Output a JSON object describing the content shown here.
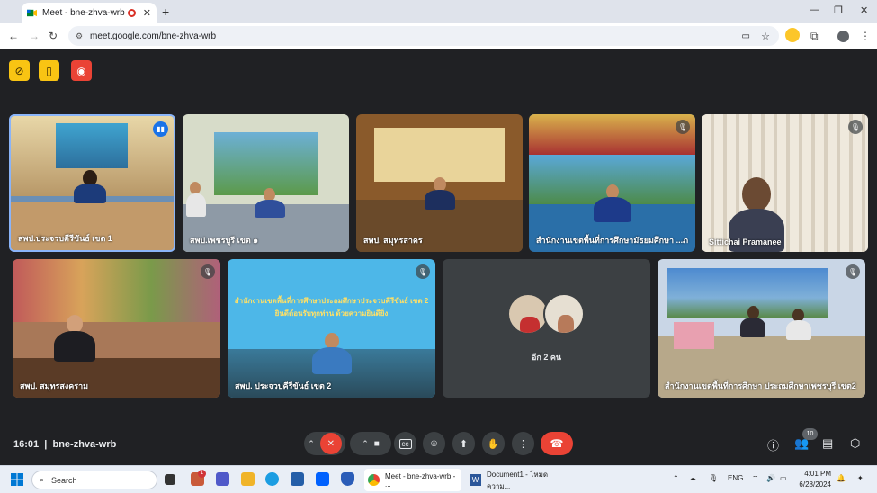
{
  "browser": {
    "tab_title": "Meet - bne-zhva-wrb",
    "tab_close": "✕",
    "new_tab": "+",
    "minimize": "—",
    "maximize": "❐",
    "close": "✕",
    "url": "meet.google.com/bne-zhva-wrb"
  },
  "meet": {
    "tiles": [
      {
        "name": "สพป.ประจวบคีรีขันธ์ เขต 1"
      },
      {
        "name": "สพป.เพชรบุรี เขต ๑"
      },
      {
        "name": "สพป. สมุทรสาคร"
      },
      {
        "name": "สำนักงานเขตพื้นที่การศึกษามัธยมศึกษา ...ภ"
      },
      {
        "name": "Sittichai Pramanee"
      },
      {
        "name": "สพป. สมุทรสงคราม"
      },
      {
        "name": "สพป. ประจวบคีรีขันธ์ เขต 2"
      },
      {
        "name": "อีก 2 คน"
      },
      {
        "name": "สำนักงานเขตพื้นที่การศึกษา ประถมศึกษาเพชรบุรี เขต2"
      }
    ],
    "banner_line1": "สำนักงานเขตพื้นที่การศึกษาประถมศึกษาประจวบคีรีขันธ์ เขต 2",
    "banner_line2": "ยินดีต้อนรับทุกท่าน ด้วยความยินดียิ่ง",
    "time": "16:01",
    "separator": "|",
    "meeting_code": "bne-zhva-wrb",
    "participant_count": "10"
  },
  "taskbar": {
    "search_placeholder": "Search",
    "app_chrome": "Meet - bne-zhva-wrb - ...",
    "app_word": "Document1 - โหมดความ...",
    "lang": "ENG",
    "clock_time": "4:01 PM",
    "clock_date": "6/28/2024",
    "notification_badge": "1"
  },
  "colors": {
    "meet_bg": "#202124",
    "end_call": "#ea4335",
    "active_speaker": "#8ab4f8",
    "ctrl_yellow": "#f9c413"
  }
}
